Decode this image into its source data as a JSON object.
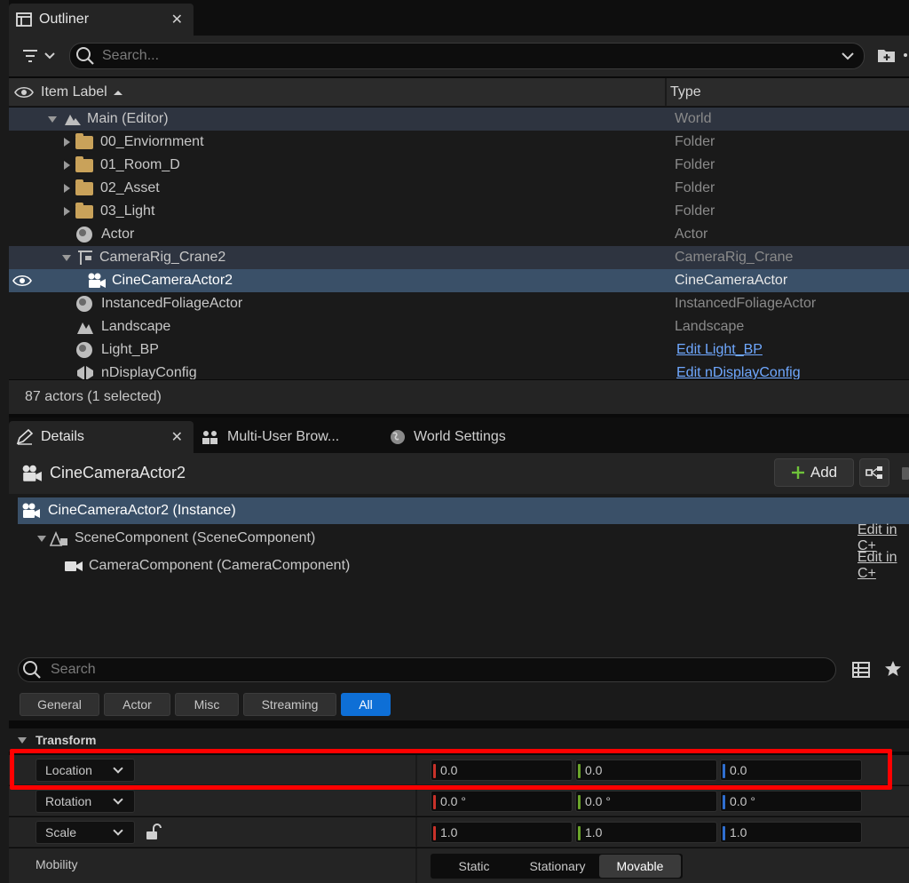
{
  "outliner": {
    "tab_label": "Outliner",
    "search_placeholder": "Search...",
    "columns": {
      "label": "Item Label",
      "type": "Type"
    },
    "rows": [
      {
        "label": "Main (Editor)",
        "type": "World"
      },
      {
        "label": "00_Enviornment",
        "type": "Folder"
      },
      {
        "label": "01_Room_D",
        "type": "Folder"
      },
      {
        "label": "02_Asset",
        "type": "Folder"
      },
      {
        "label": "03_Light",
        "type": "Folder"
      },
      {
        "label": "Actor",
        "type": "Actor"
      },
      {
        "label": "CameraRig_Crane2",
        "type": "CameraRig_Crane"
      },
      {
        "label": "CineCameraActor2",
        "type": "CineCameraActor"
      },
      {
        "label": "InstancedFoliageActor",
        "type": "InstancedFoliageActor"
      },
      {
        "label": "Landscape",
        "type": "Landscape"
      },
      {
        "label": "Light_BP",
        "type": "Edit Light_BP"
      },
      {
        "label": "nDisplayConfig",
        "type": "Edit nDisplayConfig"
      }
    ],
    "status": "87 actors (1 selected)"
  },
  "details": {
    "tabs": [
      "Details",
      "Multi-User Brow...",
      "World Settings"
    ],
    "actor_name": "CineCameraActor2",
    "add_label": "Add",
    "components": [
      {
        "label": "CineCameraActor2 (Instance)",
        "edit": ""
      },
      {
        "label": "SceneComponent (SceneComponent)",
        "edit": "Edit in C+"
      },
      {
        "label": "CameraComponent (CameraComponent)",
        "edit": "Edit in C+"
      }
    ],
    "search_placeholder": "Search",
    "filters": [
      "General",
      "Actor",
      "Misc",
      "Streaming",
      "All"
    ],
    "transform_label": "Transform",
    "location": {
      "label": "Location",
      "x": "0.0",
      "y": "0.0",
      "z": "0.0"
    },
    "rotation": {
      "label": "Rotation",
      "x": "0.0 °",
      "y": "0.0 °",
      "z": "0.0 °"
    },
    "scale": {
      "label": "Scale",
      "x": "1.0",
      "y": "1.0",
      "z": "1.0"
    },
    "mobility": {
      "label": "Mobility",
      "options": [
        "Static",
        "Stationary",
        "Movable"
      ]
    }
  },
  "colors": {
    "accent": "#0e6fd6",
    "x_axis": "#c8322a",
    "y_axis": "#6aa52a",
    "z_axis": "#2f6fd0",
    "highlight": "#ff0000"
  }
}
